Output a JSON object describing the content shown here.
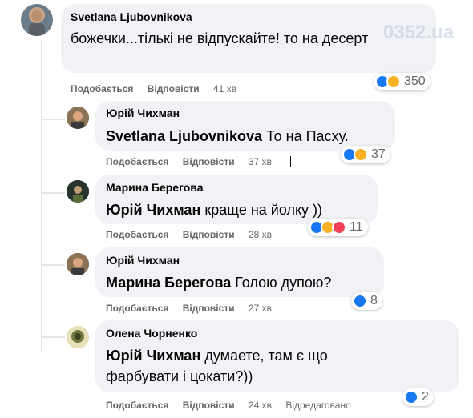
{
  "watermark": "0352.ua",
  "labels": {
    "like": "Подобається",
    "reply": "Відповісти"
  },
  "comments": [
    {
      "author": "Svetlana Ljubovnikova",
      "mention": "",
      "text": "божечки...тількі не відпускайте! то на десерт",
      "time": "41 хв",
      "edited": "",
      "reaction_count": "350",
      "reactions": [
        "like-icon",
        "haha-icon"
      ]
    },
    {
      "author": "Юрій Чихман",
      "mention": "Svetlana Ljubovnikova",
      "text": " То на Пасху.",
      "time": "37 хв",
      "edited": "",
      "reaction_count": "37",
      "reactions": [
        "like-icon",
        "haha-icon"
      ]
    },
    {
      "author": "Марина Берегова",
      "mention": "Юрій Чихман",
      "text": " краще на йолку ))",
      "time": "28 хв",
      "edited": "",
      "reaction_count": "11",
      "reactions": [
        "like-icon",
        "haha-icon",
        "love-icon"
      ]
    },
    {
      "author": "Юрій Чихман",
      "mention": "Марина Берегова",
      "text": " Голою дупою?",
      "time": "27 хв",
      "edited": "",
      "reaction_count": "8",
      "reactions": [
        "like-icon"
      ]
    },
    {
      "author": "Олена Чорненко",
      "mention": "Юрій Чихман",
      "text": " думаете, там є що фарбувати і цокати?))",
      "time": "24 хв",
      "edited": "Відредаговано",
      "reaction_count": "2",
      "reactions": [
        "like-icon"
      ]
    }
  ],
  "colors": {
    "bubble": "#f0f2f5",
    "like": "#1877f2",
    "haha": "#f7b125",
    "love": "#f33e58",
    "meta": "#65676b"
  }
}
